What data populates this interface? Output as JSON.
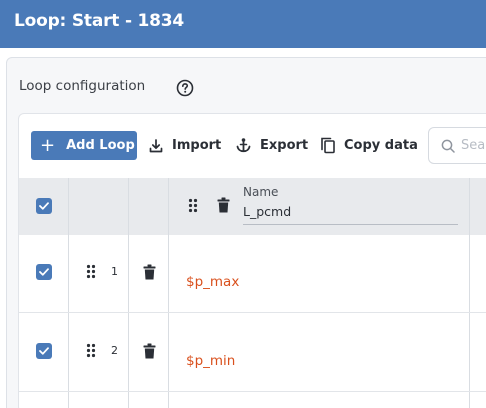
{
  "window": {
    "title": "Loop: Start - 1834"
  },
  "section": {
    "title": "Loop configuration",
    "help_icon": "question-circle-icon"
  },
  "toolbar": {
    "add_label": "Add Loop",
    "import_label": "Import",
    "export_label": "Export",
    "copy_label": "Copy data",
    "search_placeholder": "Sea"
  },
  "table": {
    "header_select_all": true,
    "columns": [
      {
        "label": "Name",
        "filter_value": "L_pcmd"
      }
    ],
    "rows": [
      {
        "index": "1",
        "selected": true,
        "value": "$p_max"
      },
      {
        "index": "2",
        "selected": true,
        "value": "$p_min"
      }
    ]
  },
  "colors": {
    "accent": "#4a7ab8",
    "value_text": "#d9501d",
    "header_bg": "#e8eaed"
  }
}
